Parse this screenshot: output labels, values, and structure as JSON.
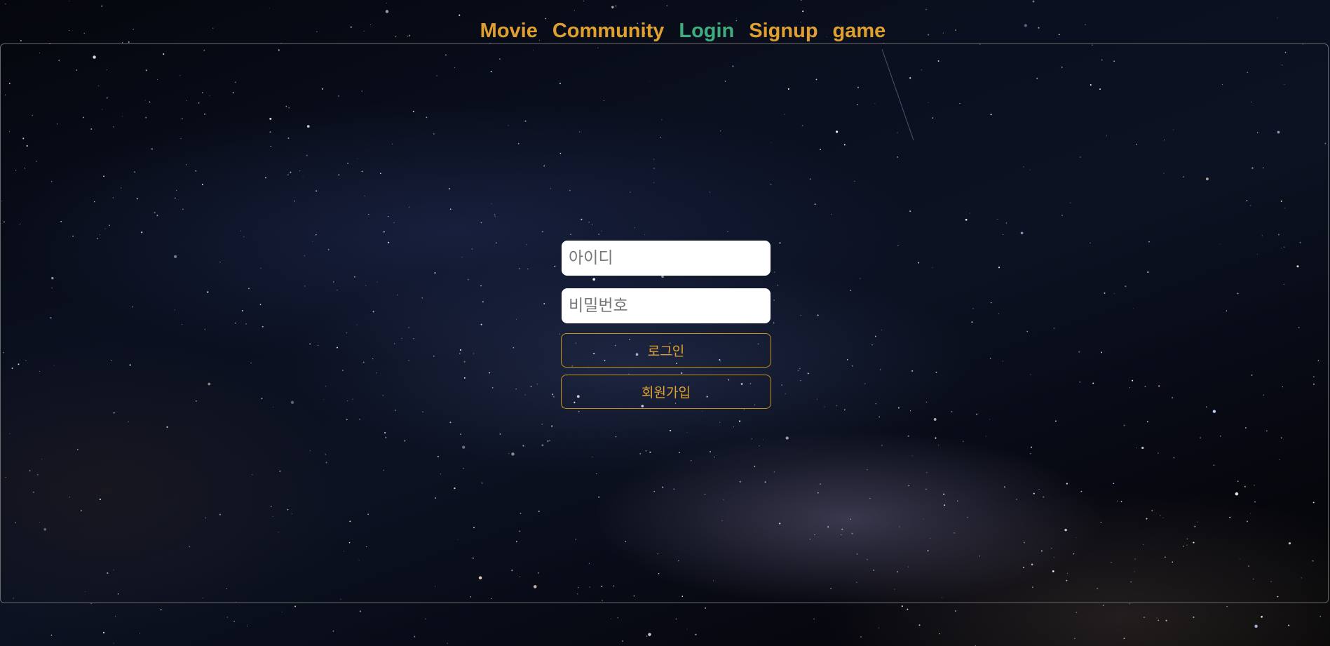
{
  "nav": {
    "items": [
      {
        "label": "Movie",
        "active": false
      },
      {
        "label": "Community",
        "active": false
      },
      {
        "label": "Login",
        "active": true
      },
      {
        "label": "Signup",
        "active": false
      },
      {
        "label": "game",
        "active": false
      }
    ]
  },
  "login": {
    "id_placeholder": "아이디",
    "password_placeholder": "비밀번호",
    "login_button": "로그인",
    "signup_button": "회원가입"
  },
  "colors": {
    "nav_link": "#e0a030",
    "nav_active": "#3fae7f",
    "button_border": "#c8901c"
  }
}
